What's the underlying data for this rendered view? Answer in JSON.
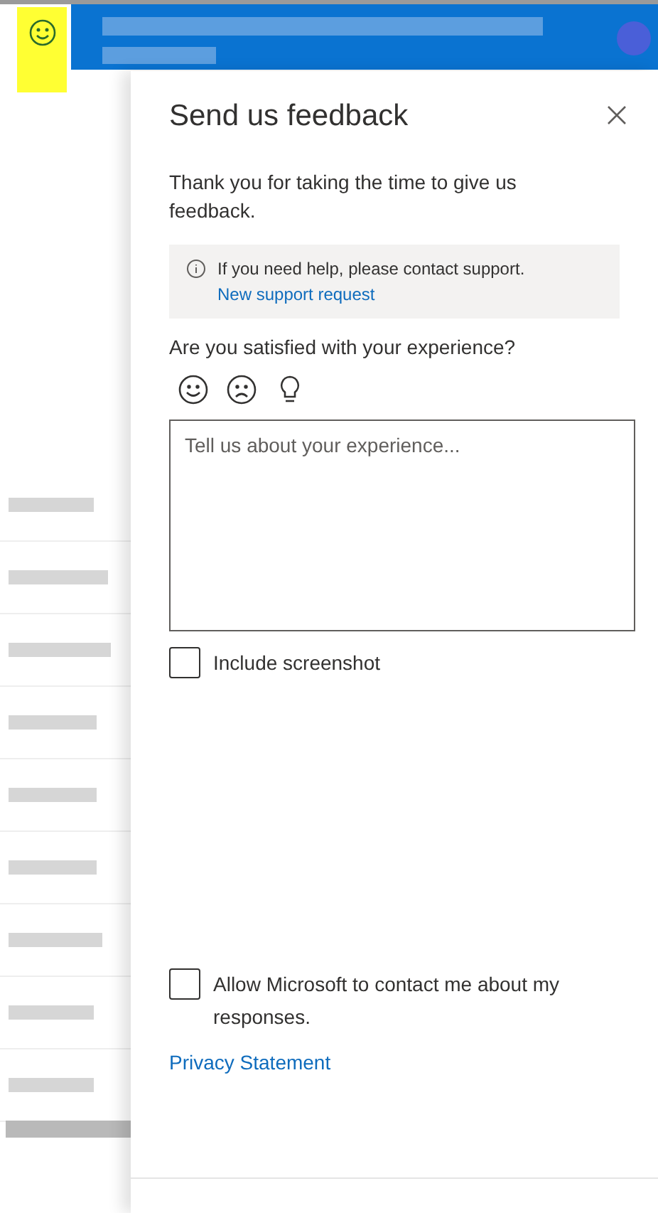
{
  "panel": {
    "title": "Send us feedback",
    "intro": "Thank you for taking the time to give us feedback.",
    "notice": {
      "text": "If you need help, please contact support.",
      "link": "New support request"
    },
    "question": "Are you satisfied with your experience?",
    "reactions": [
      {
        "kind": "smile"
      },
      {
        "kind": "frown"
      },
      {
        "kind": "idea"
      }
    ],
    "comment": {
      "placeholder": "Tell us about your experience..."
    },
    "checkboxes": [
      {
        "label": "Include screenshot",
        "checked": false
      },
      {
        "label": "Allow Microsoft to contact me about my responses.",
        "checked": false
      }
    ],
    "privacy_link": "Privacy Statement"
  }
}
